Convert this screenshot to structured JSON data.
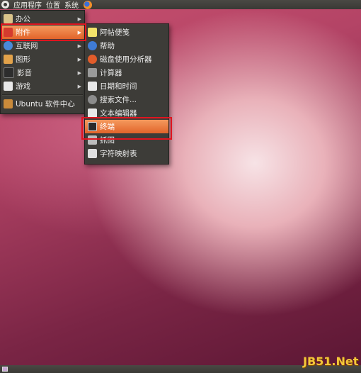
{
  "top_panel": {
    "applications": "应用程序",
    "places": "位置",
    "system": "系统"
  },
  "main_menu": {
    "items": [
      {
        "label": "办公",
        "icon": "office-icon",
        "color": "#d9c38a",
        "submenu": true
      },
      {
        "label": "附件",
        "icon": "accessories-icon",
        "color": "#d43b2e",
        "submenu": true,
        "active": true
      },
      {
        "label": "互联网",
        "icon": "internet-icon",
        "color": "#4a8ad8",
        "submenu": true
      },
      {
        "label": "图形",
        "icon": "graphics-icon",
        "color": "#e2a24a",
        "submenu": true
      },
      {
        "label": "影音",
        "icon": "sound-video-icon",
        "color": "#2d2d2d",
        "submenu": true
      },
      {
        "label": "游戏",
        "icon": "games-icon",
        "color": "#e8e8e8",
        "submenu": true
      },
      {
        "label": "Ubuntu 软件中心",
        "icon": "software-center-icon",
        "color": "#c98a3a",
        "submenu": false
      }
    ]
  },
  "accessories_menu": {
    "items": [
      {
        "label": "阿帖便笺",
        "icon": "sticky-notes-icon",
        "color": "#f2e26a"
      },
      {
        "label": "帮助",
        "icon": "help-icon",
        "color": "#3f7bd6"
      },
      {
        "label": "磁盘使用分析器",
        "icon": "disk-analyzer-icon",
        "color": "#e25c2a"
      },
      {
        "label": "计算器",
        "icon": "calculator-icon",
        "color": "#9a9a9a"
      },
      {
        "label": "日期和时间",
        "icon": "calendar-icon",
        "color": "#e8e8e8"
      },
      {
        "label": "搜索文件...",
        "icon": "search-files-icon",
        "color": "#8c8c8c"
      },
      {
        "label": "文本编辑器",
        "icon": "text-editor-icon",
        "color": "#e8e8e8"
      },
      {
        "label": "终端",
        "icon": "terminal-icon",
        "color": "#2b2b2b",
        "active": true
      },
      {
        "label": "抓图",
        "icon": "screenshot-icon",
        "color": "#bdbdbd"
      },
      {
        "label": "字符映射表",
        "icon": "character-map-icon",
        "color": "#e0e0e0"
      }
    ]
  },
  "watermark": "JB51.Net"
}
